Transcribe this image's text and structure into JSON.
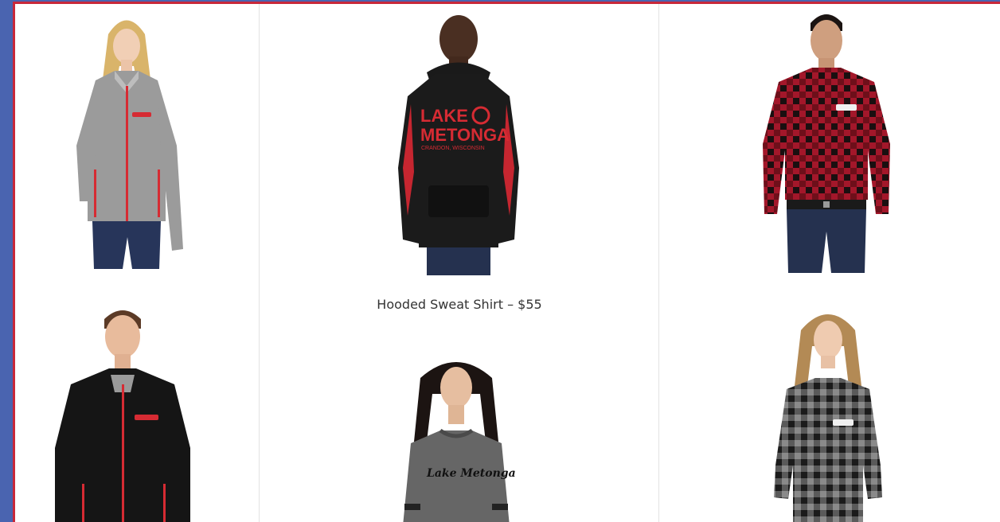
{
  "colors": {
    "page_background": "#4a64b0",
    "frame_accent": "#c8283a",
    "brand_red": "#d62b33"
  },
  "products": [
    {
      "name": "womens-gray-zip-jacket"
    },
    {
      "name": "hooded-sweat-shirt",
      "caption": "Hooded Sweat Shirt – $55",
      "print_line1": "LAKE",
      "print_line2": "METONGA",
      "print_line3": "CRANDON, WISCONSIN"
    },
    {
      "name": "mens-red-plaid-shirt"
    },
    {
      "name": "mens-black-zip-jacket"
    },
    {
      "name": "womens-gray-crew-sweatshirt",
      "print_script": "Lake Metonga"
    },
    {
      "name": "womens-gray-plaid-shirt"
    }
  ]
}
